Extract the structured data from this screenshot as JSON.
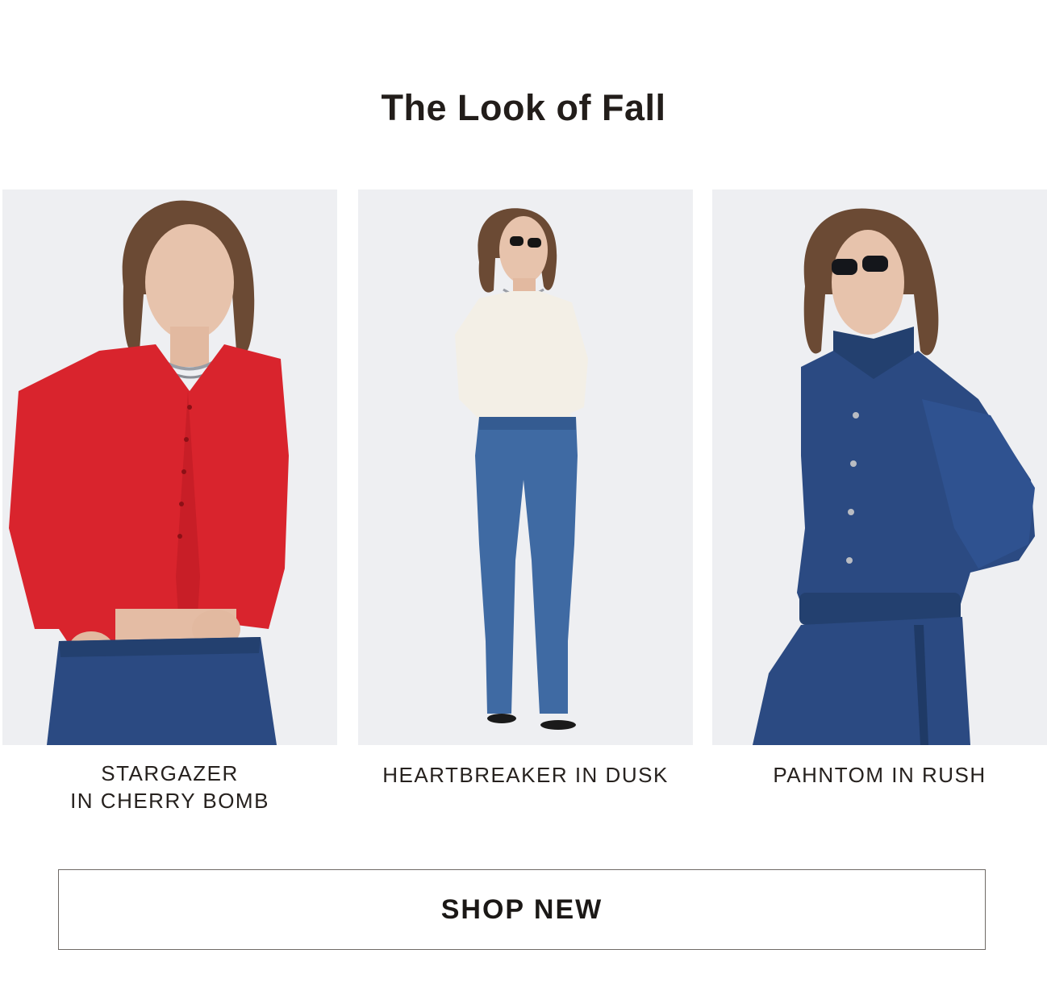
{
  "section": {
    "title": "The Look of Fall"
  },
  "products": [
    {
      "name_line1": "STARGAZER",
      "name_line2": "IN CHERRY BOMB",
      "image_icon": "model-red-cardigan-photo"
    },
    {
      "name_line1": "HEARTBREAKER IN DUSK",
      "name_line2": "",
      "image_icon": "model-white-top-flare-jeans-photo"
    },
    {
      "name_line1": "PAHNTOM IN RUSH",
      "name_line2": "",
      "image_icon": "model-denim-jacket-photo"
    }
  ],
  "cta": {
    "label": "SHOP NEW"
  },
  "colors": {
    "photo_bg": "#eeeff2",
    "red_top": "#d9242d",
    "denim": "#2b4a82",
    "light_denim": "#3f6aa3",
    "cream_top": "#f3efe6",
    "hair": "#6b4a34",
    "skin": "#e7c3ac"
  }
}
